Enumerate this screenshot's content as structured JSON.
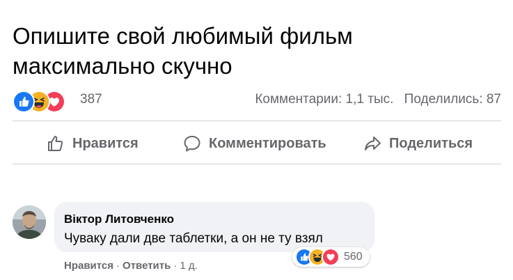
{
  "post": {
    "title_line1": "Опишите свой любимый фильм",
    "title_line2": "максимально скучно",
    "reactions": {
      "count": "387",
      "icons": [
        "like-icon",
        "haha-icon",
        "love-icon"
      ]
    },
    "comments_label": "Комментарии: 1,1 тыс.",
    "shares_label": "Поделились: 87"
  },
  "actions": {
    "like_label": "Нравится",
    "comment_label": "Комментировать",
    "share_label": "Поделиться"
  },
  "comment": {
    "author": "Віктор Литовченко",
    "text": "Чуваку дали две таблетки, а он не ту взял",
    "reaction_count": "560",
    "like_label": "Нравится",
    "reply_label": "Ответить",
    "time": "1 д."
  },
  "colors": {
    "like_blue": "#1877f2",
    "love_red": "#f33e58",
    "haha_yellow": "#f7b125",
    "secondary_text": "#65676b",
    "bubble_bg": "#f0f2f5"
  }
}
